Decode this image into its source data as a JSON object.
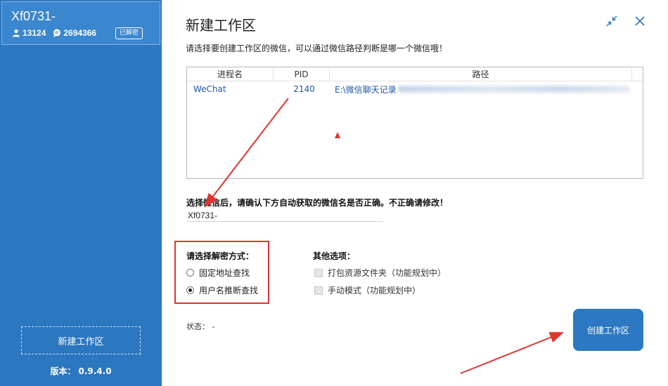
{
  "sidebar": {
    "account_name": "Xf0731-",
    "contacts_count": "13124",
    "messages_count": "2694366",
    "badge": "已解密",
    "new_workspace_label": "新建工作区",
    "version_label": "版本：",
    "version_value": "0.9.4.0"
  },
  "dialog": {
    "title": "新建工作区",
    "subtitle": "请选择要创建工作区的微信，可以通过微信路径判断是哪一个微信哦！",
    "table": {
      "headers": [
        "进程名",
        "PID",
        "路径"
      ],
      "rows": [
        {
          "process": "WeChat",
          "pid": "2140",
          "path": "E:\\微信聊天记录"
        }
      ]
    },
    "confirm_label": "选择微信后，请确认下方自动获取的微信名是否正确。不正确请修改！",
    "wechat_name_value": "Xf0731-",
    "decrypt": {
      "title": "请选择解密方式：",
      "options": [
        "固定地址查找",
        "用户名推断查找"
      ],
      "selected_index": 1
    },
    "other": {
      "title": "其他选项：",
      "options": [
        "打包资源文件夹（功能规划中）",
        "手动模式（功能规划中）"
      ]
    },
    "status_label": "状态：",
    "status_value": "-",
    "create_button": "创建工作区"
  },
  "icons": {
    "user": "user-icon",
    "chat": "chat-bubble-icon",
    "collapse": "collapse-icon",
    "close": "close-icon"
  },
  "colors": {
    "sidebar_bg": "#2b77c0",
    "primary_button": "#2c78c2",
    "highlight_red": "#e0342f",
    "link_blue": "#1f56a8"
  }
}
